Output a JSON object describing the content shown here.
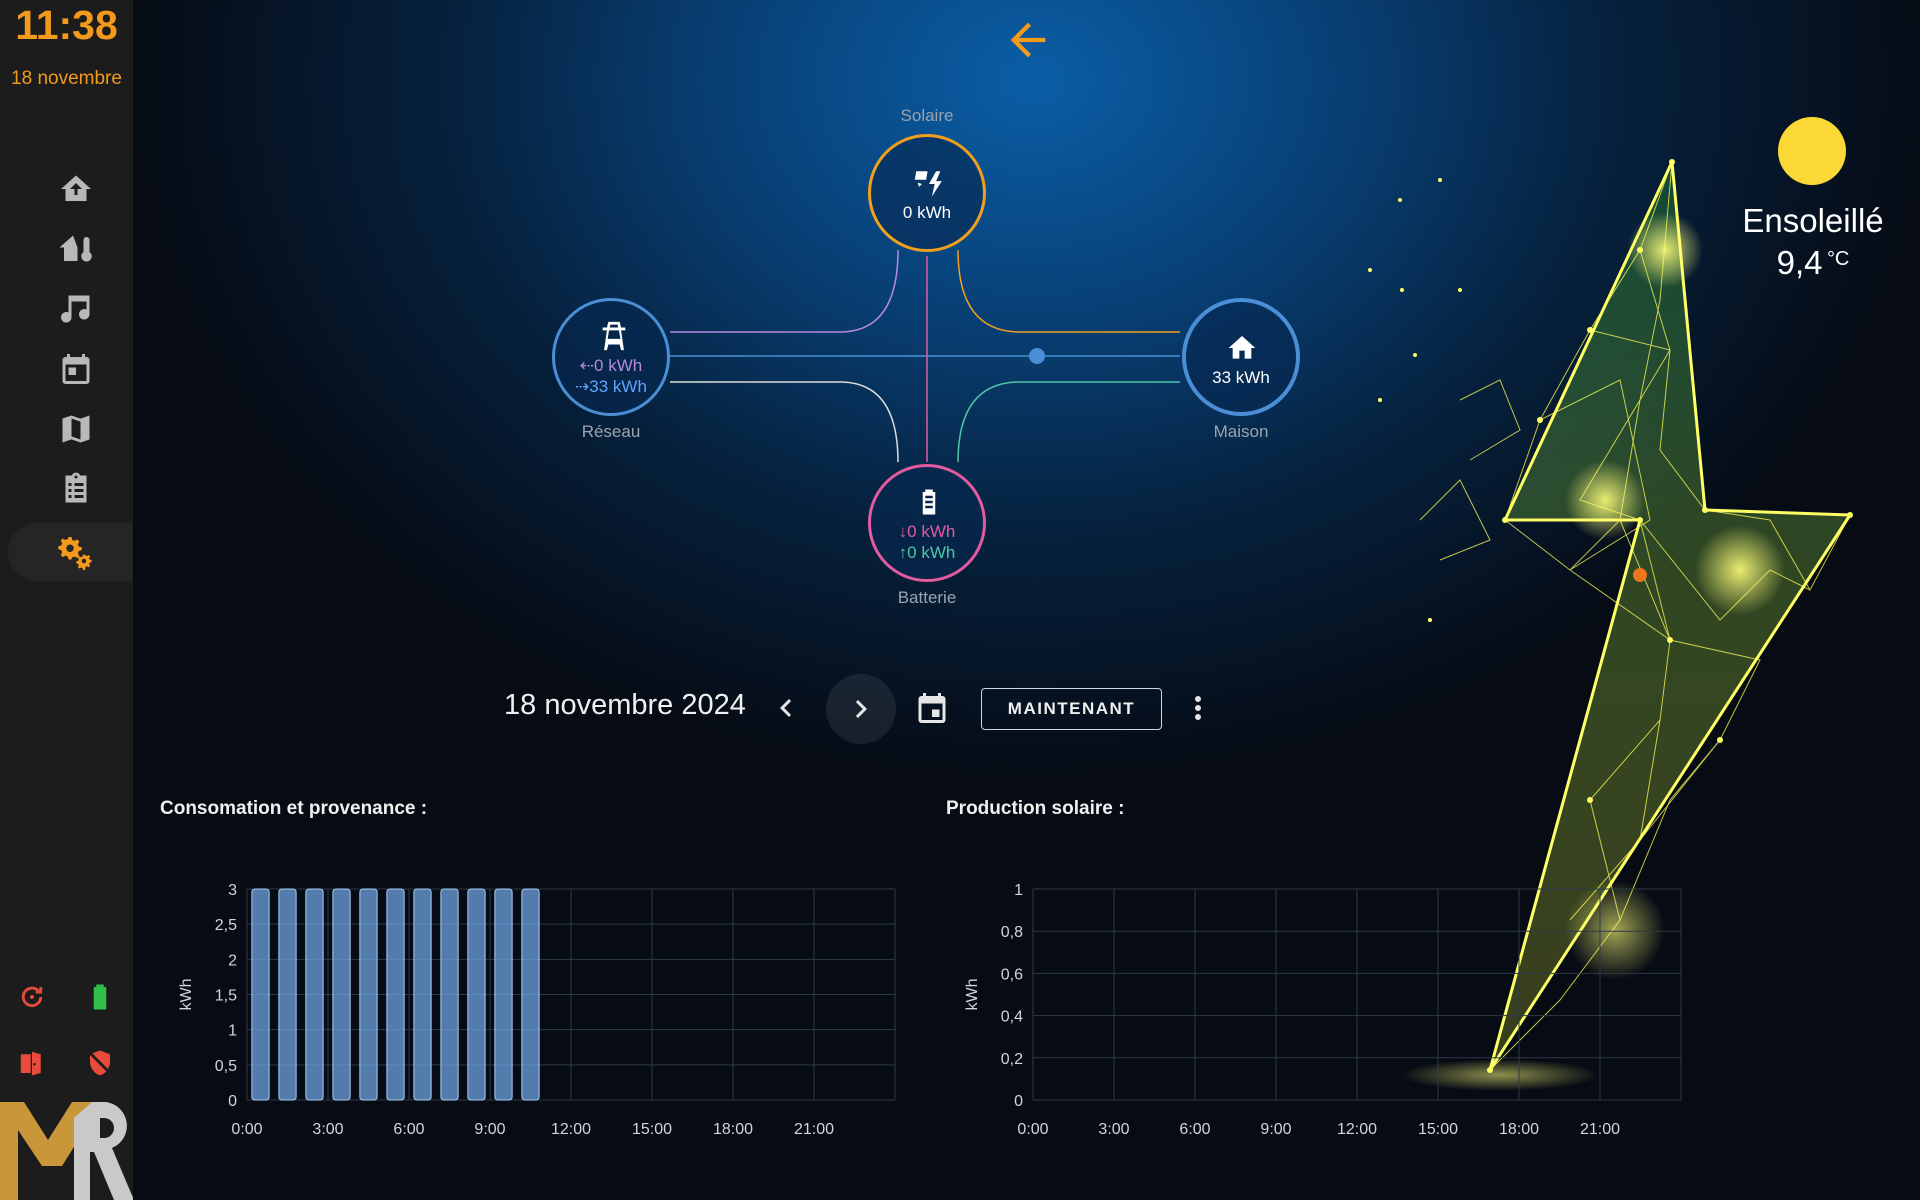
{
  "sidebar": {
    "time": "11:38",
    "date": "18 novembre",
    "nav": [
      {
        "name": "home-share-icon"
      },
      {
        "name": "home-thermometer-icon"
      },
      {
        "name": "music-icon"
      },
      {
        "name": "calendar-icon"
      },
      {
        "name": "map-icon"
      },
      {
        "name": "clipboard-list-icon"
      },
      {
        "name": "cogs-icon",
        "active": true
      }
    ],
    "status_icons": [
      "refresh-alert-icon",
      "battery-icon",
      "door-open-icon",
      "shield-off-icon"
    ],
    "logo": "MR"
  },
  "header": {
    "back_icon": "arrow-left-icon"
  },
  "energy": {
    "solar": {
      "label": "Solaire",
      "value": "0 kWh"
    },
    "grid": {
      "label": "Réseau",
      "import": "0 kWh",
      "export": "33 kWh"
    },
    "home": {
      "label": "Maison",
      "value": "33 kWh"
    },
    "battery": {
      "label": "Batterie",
      "in": "0 kWh",
      "out": "0 kWh"
    }
  },
  "weather": {
    "condition": "Ensoleillé",
    "temperature": "9,4",
    "unit": "°C"
  },
  "date_picker": {
    "date": "18 novembre 2024",
    "now_label": "MAINTENANT"
  },
  "colors": {
    "accent": "#f39a1d",
    "solar": "#f0a01e",
    "grid": "#4a8fd6",
    "home": "#4a8fd6",
    "battery": "#e25aa0",
    "grid_import": "#b58be0",
    "grid_export": "#5ea6ff",
    "battery_out": "#4fc6a8",
    "bar": "#6ea3e0"
  },
  "chart_data": [
    {
      "type": "bar",
      "title": "Consomation et provenance :",
      "ylabel": "kWh",
      "ylim": [
        0,
        3
      ],
      "yticks": [
        "0",
        "0,5",
        "1",
        "1,5",
        "2",
        "2,5",
        "3"
      ],
      "xticks": [
        "0:00",
        "3:00",
        "6:00",
        "9:00",
        "12:00",
        "15:00",
        "18:00",
        "21:00"
      ],
      "categories": [
        "0:00",
        "1:00",
        "2:00",
        "3:00",
        "4:00",
        "5:00",
        "6:00",
        "7:00",
        "8:00",
        "9:00",
        "10:00",
        "11:00",
        "12:00",
        "13:00",
        "14:00",
        "15:00",
        "16:00",
        "17:00",
        "18:00",
        "19:00",
        "20:00",
        "21:00",
        "22:00",
        "23:00"
      ],
      "values": [
        3,
        3,
        3,
        3,
        3,
        3,
        3,
        3,
        3,
        3,
        3,
        null,
        null,
        null,
        null,
        null,
        null,
        null,
        null,
        null,
        null,
        null,
        null,
        null
      ]
    },
    {
      "type": "bar",
      "title": "Production solaire :",
      "ylabel": "kWh",
      "ylim": [
        0,
        1
      ],
      "yticks": [
        "0",
        "0,2",
        "0,4",
        "0,6",
        "0,8",
        "1"
      ],
      "xticks": [
        "0:00",
        "3:00",
        "6:00",
        "9:00",
        "12:00",
        "15:00",
        "18:00",
        "21:00"
      ],
      "categories": [
        "0:00",
        "1:00",
        "2:00",
        "3:00",
        "4:00",
        "5:00",
        "6:00",
        "7:00",
        "8:00",
        "9:00",
        "10:00",
        "11:00",
        "12:00",
        "13:00",
        "14:00",
        "15:00",
        "16:00",
        "17:00",
        "18:00",
        "19:00",
        "20:00",
        "21:00",
        "22:00",
        "23:00"
      ],
      "values": []
    }
  ]
}
